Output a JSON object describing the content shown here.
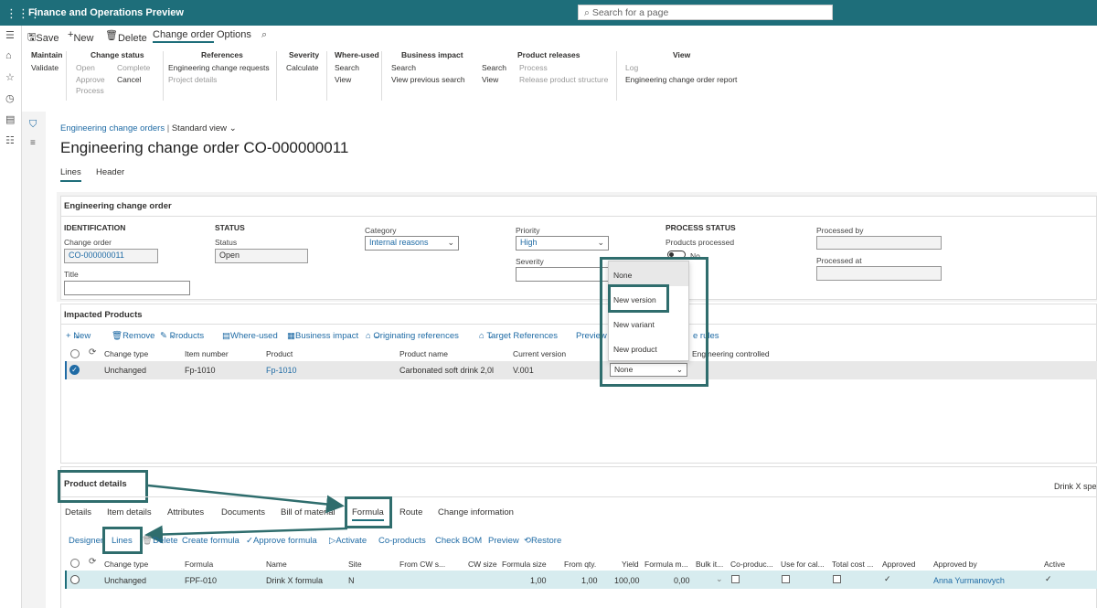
{
  "app": {
    "title": "Finance and Operations Preview",
    "search_placeholder": "Search for a page"
  },
  "actionbar": {
    "save": "Save",
    "new": "New",
    "delete": "Delete",
    "change_order": "Change order",
    "options": "Options"
  },
  "ribbon": {
    "maintain": {
      "title": "Maintain",
      "validate": "Validate"
    },
    "change_status": {
      "title": "Change status",
      "open": "Open",
      "approve": "Approve",
      "process": "Process",
      "complete": "Complete",
      "cancel": "Cancel"
    },
    "references": {
      "title": "References",
      "ecr": "Engineering change requests",
      "project": "Project details"
    },
    "severity": {
      "title": "Severity",
      "calculate": "Calculate"
    },
    "where_used": {
      "title": "Where-used",
      "search": "Search",
      "view": "View"
    },
    "business_impact": {
      "title": "Business impact",
      "search": "Search",
      "view_prev": "View previous search"
    },
    "product_releases": {
      "title": "Product releases",
      "search": "Search",
      "view": "View",
      "process": "Process",
      "release": "Release product structure"
    },
    "view": {
      "title": "View",
      "log": "Log",
      "report": "Engineering change order report"
    }
  },
  "page": {
    "breadcrumb": "Engineering change orders",
    "view_label": "Standard view",
    "title": "Engineering change order CO-000000011",
    "tab_lines": "Lines",
    "tab_header": "Header"
  },
  "eco": {
    "section": "Engineering change order",
    "identification": "IDENTIFICATION",
    "change_order_label": "Change order",
    "change_order_value": "CO-000000011",
    "title_label": "Title",
    "status_hdr": "STATUS",
    "status_label": "Status",
    "status_value": "Open",
    "category_label": "Category",
    "category_value": "Internal reasons",
    "priority_label": "Priority",
    "priority_value": "High",
    "severity_label": "Severity",
    "process_status": "PROCESS STATUS",
    "products_processed": "Products processed",
    "toggle_value": "No",
    "processed_by": "Processed by",
    "processed_at": "Processed at"
  },
  "impacted": {
    "section": "Impacted Products",
    "toolbar": {
      "new": "New",
      "remove": "Remove",
      "products": "Products",
      "where_used": "Where-used",
      "business_impact": "Business impact",
      "orig_refs": "Originating references",
      "target_refs": "Target References",
      "preview": "Preview",
      "rules": "e rules"
    },
    "columns": [
      "Change type",
      "Item number",
      "Product",
      "Product name",
      "Current version",
      "Engineering controlled"
    ],
    "row": {
      "change_type": "Unchanged",
      "item": "Fp-1010",
      "product": "Fp-1010",
      "name": "Carbonated soft drink 2,0l",
      "version": "V.001",
      "new_product": "None"
    }
  },
  "dropdown": {
    "options": [
      "None",
      "New version",
      "New variant",
      "New product"
    ]
  },
  "details": {
    "section": "Product details",
    "right_text": "Drink X spe",
    "tabs": [
      "Details",
      "Item details",
      "Attributes",
      "Documents",
      "Bill of material",
      "Formula",
      "Route",
      "Change information"
    ],
    "toolbar": {
      "designer": "Designer",
      "lines": "Lines",
      "delete": "Delete",
      "create_formula": "Create formula",
      "approve_formula": "Approve formula",
      "activate": "Activate",
      "coproducts": "Co-products",
      "check_bom": "Check BOM",
      "preview": "Preview",
      "restore": "Restore"
    },
    "columns": [
      "Change type",
      "Formula",
      "Name",
      "Site",
      "From CW s...",
      "CW size",
      "Formula size",
      "From qty.",
      "Yield",
      "Formula m...",
      "Bulk it...",
      "Co-produc...",
      "Use for cal...",
      "Total cost ...",
      "Approved",
      "Approved by",
      "Active"
    ],
    "row": {
      "change_type": "Unchanged",
      "formula": "FPF-010",
      "name": "Drink X formula",
      "site": "N",
      "formula_size": "1,00",
      "from_qty": "1,00",
      "yield": "100,00",
      "formula_m": "0,00",
      "approved_by": "Anna Yurmanovych"
    }
  },
  "colors": {
    "brand": "#1e6e7a",
    "highlight": "#2f6d6d",
    "link": "#1f6ba5"
  }
}
